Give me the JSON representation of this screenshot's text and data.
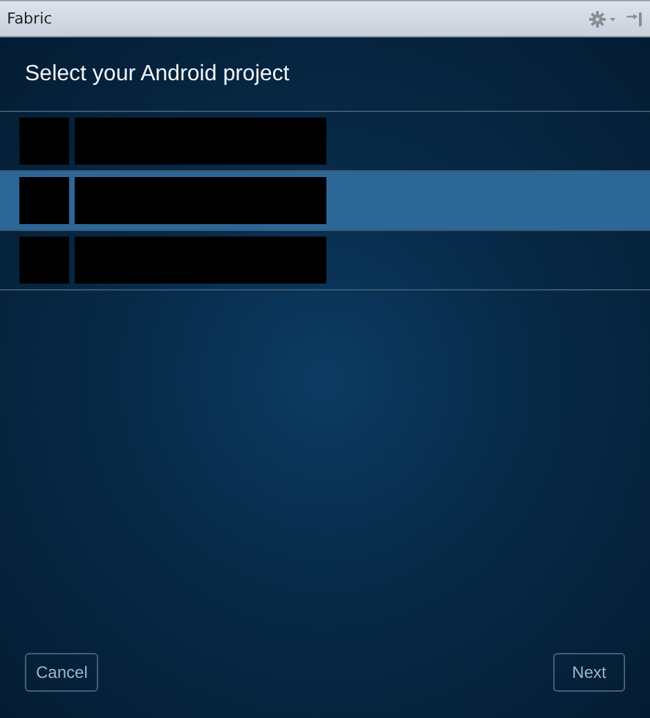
{
  "window": {
    "title": "Fabric"
  },
  "heading": "Select your Android project",
  "projects": [
    {
      "selected": false
    },
    {
      "selected": true
    },
    {
      "selected": false
    }
  ],
  "buttons": {
    "cancel": "Cancel",
    "next": "Next"
  }
}
